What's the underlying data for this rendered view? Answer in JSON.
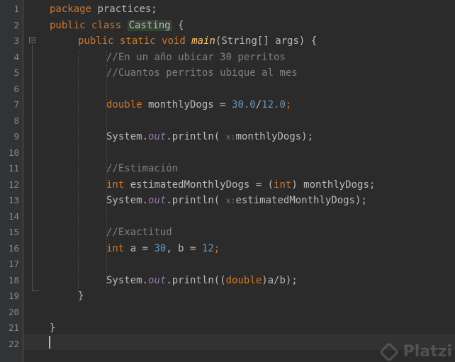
{
  "editor": {
    "line_numbers": [
      "1",
      "2",
      "3",
      "4",
      "5",
      "6",
      "7",
      "8",
      "9",
      "10",
      "11",
      "12",
      "13",
      "14",
      "15",
      "16",
      "17",
      "18",
      "19",
      "20",
      "21",
      "22"
    ]
  },
  "code": {
    "l1": {
      "kw": "package",
      "rest": " practices;"
    },
    "l2": {
      "kw1": "public",
      "kw2": "class",
      "cls": "Casting",
      "rest": " {"
    },
    "l3": {
      "kw1": "public",
      "kw2": "static",
      "kw3": "void",
      "fn": "main",
      "rest": "(String[] args) {"
    },
    "l4": {
      "comment": "//En un año ubicar 30 perritos"
    },
    "l5": {
      "comment": "//Cuantos perritos ubique al mes"
    },
    "l7": {
      "kw": "double",
      "var": " monthlyDogs = ",
      "n1": "30.0",
      "op": "/",
      "n2": "12.0",
      "end": ";"
    },
    "l9": {
      "sys": "System.",
      "out": "out",
      "call": ".println( ",
      "hint": "x:",
      "arg": "monthlyDogs);"
    },
    "l11": {
      "comment": "//Estimación"
    },
    "l12": {
      "kw": "int",
      "var": " estimatedMonthlyDogs = (",
      "kw2": "int",
      "rest": ") monthlyDogs;"
    },
    "l13": {
      "sys": "System.",
      "out": "out",
      "call": ".println( ",
      "hint": "x:",
      "arg": "estimatedMonthlyDogs);"
    },
    "l15": {
      "comment": "//Exactitud"
    },
    "l16": {
      "kw": "int",
      "a": " a = ",
      "n1": "30",
      "b": ", b = ",
      "n2": "12",
      "end": ";"
    },
    "l18": {
      "sys": "System.",
      "out": "out",
      "call": ".println((",
      "kw": "double",
      "rest": ")a/b);"
    },
    "l19": {
      "brace": "}"
    },
    "l21": {
      "brace": "}"
    }
  },
  "watermark": {
    "brand": "Platzi"
  },
  "colors": {
    "background": "#2b2b2b",
    "gutter": "#313335",
    "keyword": "#cc7832",
    "method": "#ffc66d",
    "number": "#6897bb",
    "comment": "#808080",
    "static_field": "#9876aa",
    "text": "#bababa"
  }
}
